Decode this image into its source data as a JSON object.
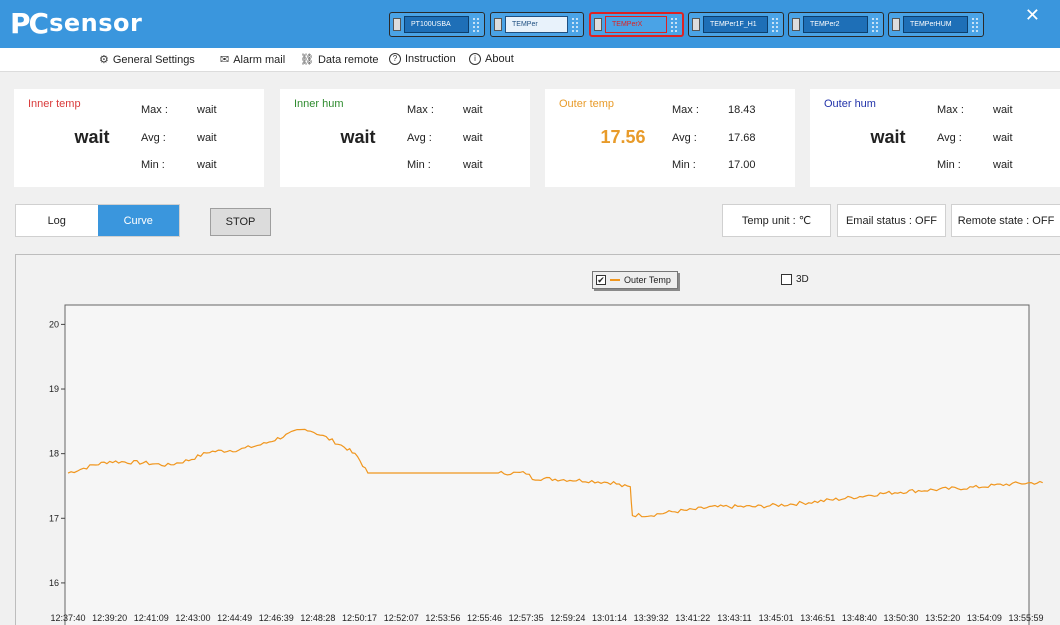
{
  "app": {
    "logo_pc": "PC",
    "logo_sensor": "sensor",
    "close_glyph": "✕"
  },
  "devices": [
    {
      "label": "PT100USBA",
      "state": "normal"
    },
    {
      "label": "TEMPer",
      "state": "selected"
    },
    {
      "label": "TEMPerX",
      "state": "active"
    },
    {
      "label": "TEMPer1F_H1",
      "state": "normal"
    },
    {
      "label": "TEMPer2",
      "state": "normal"
    },
    {
      "label": "TEMPerHUM",
      "state": "normal"
    }
  ],
  "menu": {
    "general_settings": "General Settings",
    "alarm_mail": "Alarm mail",
    "data_remote": "Data remote",
    "instruction": "Instruction",
    "about": "About"
  },
  "icons": {
    "gear": "⚙",
    "mail": "✉",
    "link": "⛓",
    "question": "?",
    "info": "i"
  },
  "cards": {
    "inner_temp": {
      "title": "Inner temp",
      "value": "wait",
      "max_label": "Max :",
      "max": "wait",
      "avg_label": "Avg :",
      "avg": "wait",
      "min_label": "Min :",
      "min": "wait",
      "title_color": "#d93a3a"
    },
    "inner_hum": {
      "title": "Inner hum",
      "value": "wait",
      "max_label": "Max :",
      "max": "wait",
      "avg_label": "Avg :",
      "avg": "wait",
      "min_label": "Min :",
      "min": "wait",
      "title_color": "#2e8b2e"
    },
    "outer_temp": {
      "title": "Outer temp",
      "value": "17.56",
      "max_label": "Max :",
      "max": "18.43",
      "avg_label": "Avg :",
      "avg": "17.68",
      "min_label": "Min :",
      "min": "17.00",
      "title_color": "#e89b2a"
    },
    "outer_hum": {
      "title": "Outer hum",
      "value": "wait",
      "max_label": "Max :",
      "max": "wait",
      "avg_label": "Avg :",
      "avg": "wait",
      "min_label": "Min :",
      "min": "wait",
      "title_color": "#2233aa"
    }
  },
  "controls": {
    "log_tab": "Log",
    "curve_tab": "Curve",
    "stop": "STOP",
    "temp_unit": "Temp unit : ℃",
    "email_status": "Email status : OFF",
    "remote_state": "Remote state : OFF",
    "accent": "#3a96dd"
  },
  "chart": {
    "legend_label": "Outer Temp",
    "legend_check": "✔",
    "three_d_label": "3D"
  },
  "chart_data": {
    "type": "line",
    "series": [
      {
        "name": "Outer Temp",
        "color": "#f0961e"
      }
    ],
    "x_tick_labels": [
      "12:37:40",
      "12:39:20",
      "12:41:09",
      "12:43:00",
      "12:44:49",
      "12:46:39",
      "12:48:28",
      "12:50:17",
      "12:52:07",
      "12:53:56",
      "12:55:46",
      "12:57:35",
      "12:59:24",
      "13:01:14",
      "13:39:32",
      "13:41:22",
      "13:43:11",
      "13:45:01",
      "13:46:51",
      "13:48:40",
      "13:50:30",
      "13:52:20",
      "13:54:09",
      "13:55:59"
    ],
    "y_ticks": [
      16,
      17,
      18,
      19,
      20
    ],
    "ylim": [
      15.55,
      20.3
    ],
    "points": [
      [
        0,
        17.7
      ],
      [
        0.6,
        17.82
      ],
      [
        1.0,
        17.88
      ],
      [
        1.8,
        17.86
      ],
      [
        2.4,
        17.82
      ],
      [
        2.9,
        17.9
      ],
      [
        3.4,
        18.03
      ],
      [
        4.1,
        18.06
      ],
      [
        4.7,
        18.15
      ],
      [
        5.1,
        18.25
      ],
      [
        5.5,
        18.35
      ],
      [
        5.75,
        18.38
      ],
      [
        6.2,
        18.25
      ],
      [
        6.7,
        18.08
      ],
      [
        6.95,
        17.95
      ],
      [
        7.2,
        17.7
      ],
      [
        8.5,
        17.7
      ],
      [
        10.4,
        17.7
      ],
      [
        11.0,
        17.7
      ],
      [
        11.15,
        17.62
      ],
      [
        11.9,
        17.6
      ],
      [
        12.5,
        17.58
      ],
      [
        13.1,
        17.55
      ],
      [
        13.3,
        17.5
      ],
      [
        13.5,
        17.48
      ],
      [
        13.55,
        17.05
      ],
      [
        14.0,
        17.05
      ],
      [
        14.5,
        17.1
      ],
      [
        15.0,
        17.13
      ],
      [
        15.4,
        17.17
      ],
      [
        15.8,
        17.18
      ],
      [
        16.5,
        17.18
      ],
      [
        17.2,
        17.21
      ],
      [
        18.0,
        17.26
      ],
      [
        18.8,
        17.32
      ],
      [
        19.5,
        17.38
      ],
      [
        20.2,
        17.42
      ],
      [
        21.0,
        17.45
      ],
      [
        21.8,
        17.48
      ],
      [
        22.6,
        17.53
      ],
      [
        23.2,
        17.55
      ],
      [
        23.4,
        17.55
      ]
    ],
    "grid": false,
    "legend_position": "top-center"
  }
}
